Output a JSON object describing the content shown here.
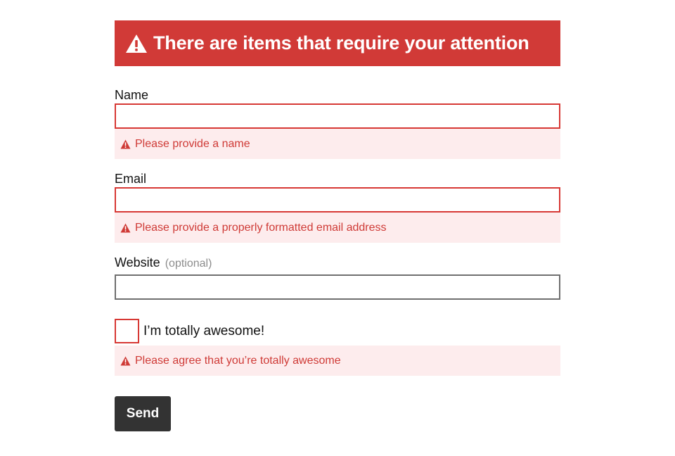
{
  "banner": {
    "title": "There are items that require your attention",
    "icon": "warning-icon",
    "color": "#d13a37"
  },
  "fields": {
    "name": {
      "label": "Name",
      "value": "",
      "error": "Please provide a name"
    },
    "email": {
      "label": "Email",
      "value": "",
      "error": "Please provide a properly formatted email address"
    },
    "website": {
      "label": "Website",
      "optional": "(optional)",
      "value": ""
    },
    "awesome": {
      "label": "I’m totally awesome!",
      "checked": false,
      "error": "Please agree that you’re totally awesome"
    }
  },
  "submit": {
    "label": "Send"
  },
  "colors": {
    "error_text": "#cf3a36",
    "error_background": "#fdeced",
    "error_border": "#d73834",
    "button_background": "#333333"
  }
}
